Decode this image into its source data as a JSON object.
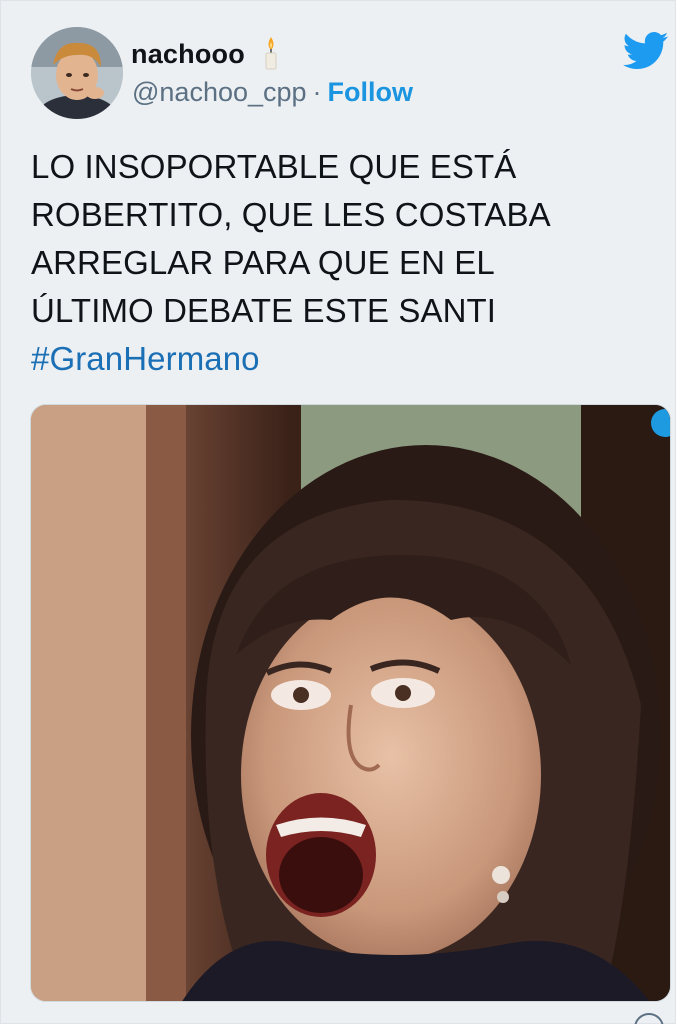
{
  "author": {
    "display_name": "nachooo",
    "handle": "@nachoo_cpp",
    "separator": "·",
    "follow_label": "Follow",
    "avatar_icon": "avatar",
    "badge_icon": "candle-icon"
  },
  "brand": {
    "icon": "twitter-bird-icon",
    "color": "#1d9bf0"
  },
  "tweet": {
    "lines": [
      "LO INSOPORTABLE QUE ESTÁ",
      "ROBERTITO, QUE LES COSTABA",
      "ARREGLAR PARA QUE EN EL",
      "ÚLTIMO DEBATE ESTE SANTI"
    ],
    "hashtag": "#GranHermano",
    "hashtag_color": "#1b6fb5"
  },
  "media": {
    "kind": "image",
    "icon": "tweet-photo"
  }
}
